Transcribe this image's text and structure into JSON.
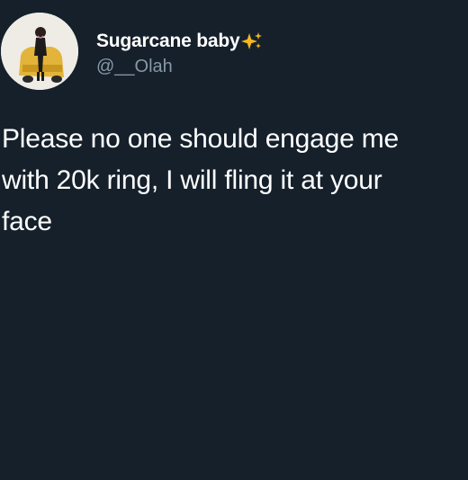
{
  "tweet": {
    "author": {
      "display_name": "Sugarcane baby",
      "verified_emoji": "sparkles-icon",
      "handle": "@__Olah"
    },
    "text": "Please no one should engage me\nwith 20k ring, I will fling it at your\nface"
  },
  "colors": {
    "background": "#15202b",
    "text_primary": "#ffffff",
    "text_secondary": "#8899a6",
    "sparkle": "#f5b71e"
  }
}
